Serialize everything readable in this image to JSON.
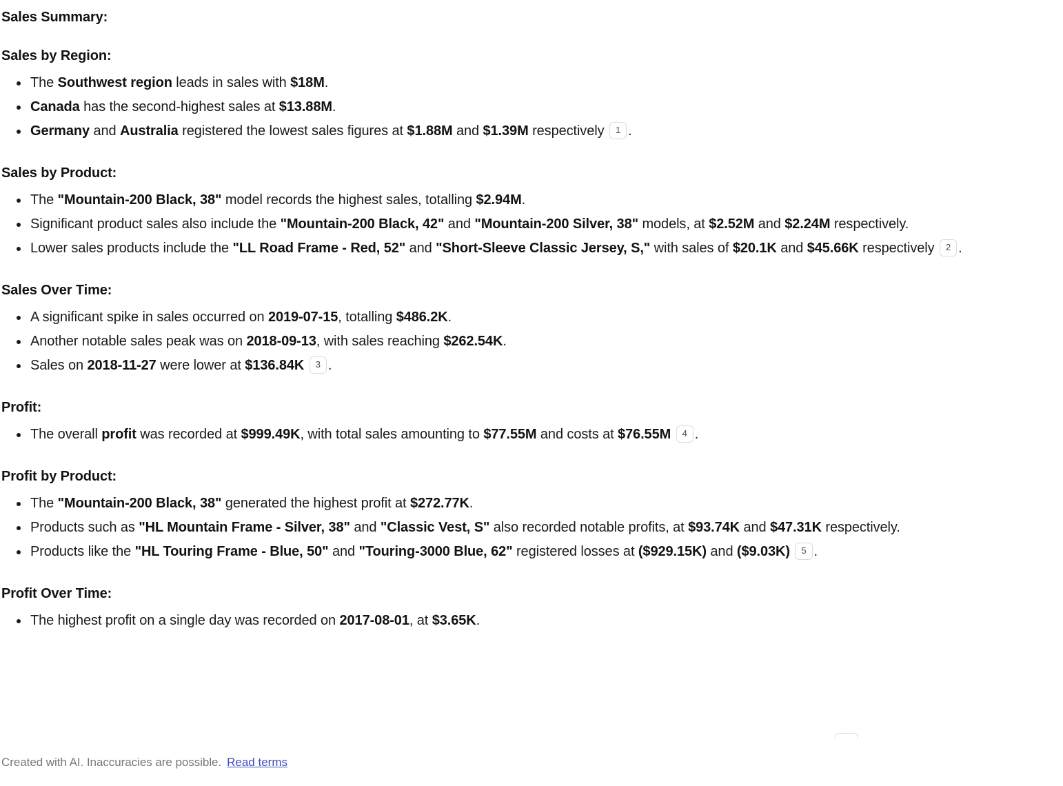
{
  "document": {
    "title": "Sales Summary:",
    "sections": [
      {
        "heading": "Sales by Region:",
        "bullets": [
          [
            {
              "t": "The ",
              "s": "n"
            },
            {
              "t": "Southwest region",
              "s": "b"
            },
            {
              "t": " leads in sales with ",
              "s": "n"
            },
            {
              "t": "$18M",
              "s": "b"
            },
            {
              "t": ".",
              "s": "n"
            }
          ],
          [
            {
              "t": "Canada",
              "s": "b"
            },
            {
              "t": " has the second-highest sales at ",
              "s": "n"
            },
            {
              "t": "$13.88M",
              "s": "b"
            },
            {
              "t": ".",
              "s": "n"
            }
          ],
          [
            {
              "t": "Germany",
              "s": "b"
            },
            {
              "t": " and ",
              "s": "n"
            },
            {
              "t": "Australia",
              "s": "b"
            },
            {
              "t": " registered the lowest sales figures at ",
              "s": "n"
            },
            {
              "t": "$1.88M",
              "s": "b"
            },
            {
              "t": " and ",
              "s": "n"
            },
            {
              "t": "$1.39M",
              "s": "b"
            },
            {
              "t": " respectively ",
              "s": "n"
            },
            {
              "t": "1",
              "s": "c"
            },
            {
              "t": ".",
              "s": "n"
            }
          ]
        ]
      },
      {
        "heading": "Sales by Product:",
        "bullets": [
          [
            {
              "t": "The ",
              "s": "n"
            },
            {
              "t": "\"Mountain-200 Black, 38\"",
              "s": "b"
            },
            {
              "t": " model records the highest sales, totalling ",
              "s": "n"
            },
            {
              "t": "$2.94M",
              "s": "b"
            },
            {
              "t": ".",
              "s": "n"
            }
          ],
          [
            {
              "t": "Significant product sales also include the ",
              "s": "n"
            },
            {
              "t": "\"Mountain-200 Black, 42\"",
              "s": "b"
            },
            {
              "t": " and ",
              "s": "n"
            },
            {
              "t": "\"Mountain-200 Silver, 38\"",
              "s": "b"
            },
            {
              "t": " models, at ",
              "s": "n"
            },
            {
              "t": "$2.52M",
              "s": "b"
            },
            {
              "t": " and ",
              "s": "n"
            },
            {
              "t": "$2.24M",
              "s": "b"
            },
            {
              "t": " respectively.",
              "s": "n"
            }
          ],
          [
            {
              "t": "Lower sales products include the ",
              "s": "n"
            },
            {
              "t": "\"LL Road Frame - Red, 52\"",
              "s": "b"
            },
            {
              "t": " and ",
              "s": "n"
            },
            {
              "t": "\"Short-Sleeve Classic Jersey, S,\"",
              "s": "b"
            },
            {
              "t": " with sales of ",
              "s": "n"
            },
            {
              "t": "$20.1K",
              "s": "b"
            },
            {
              "t": " and ",
              "s": "n"
            },
            {
              "t": "$45.66K",
              "s": "b"
            },
            {
              "t": " respectively ",
              "s": "n"
            },
            {
              "t": "2",
              "s": "c"
            },
            {
              "t": ".",
              "s": "n"
            }
          ]
        ]
      },
      {
        "heading": "Sales Over Time:",
        "bullets": [
          [
            {
              "t": "A significant spike in sales occurred on ",
              "s": "n"
            },
            {
              "t": "2019-07-15",
              "s": "b"
            },
            {
              "t": ", totalling ",
              "s": "n"
            },
            {
              "t": "$486.2K",
              "s": "b"
            },
            {
              "t": ".",
              "s": "n"
            }
          ],
          [
            {
              "t": "Another notable sales peak was on ",
              "s": "n"
            },
            {
              "t": "2018-09-13",
              "s": "b"
            },
            {
              "t": ", with sales reaching ",
              "s": "n"
            },
            {
              "t": "$262.54K",
              "s": "b"
            },
            {
              "t": ".",
              "s": "n"
            }
          ],
          [
            {
              "t": "Sales on ",
              "s": "n"
            },
            {
              "t": "2018-11-27",
              "s": "b"
            },
            {
              "t": " were lower at ",
              "s": "n"
            },
            {
              "t": "$136.84K",
              "s": "b"
            },
            {
              "t": " ",
              "s": "n"
            },
            {
              "t": "3",
              "s": "c"
            },
            {
              "t": ".",
              "s": "n"
            }
          ]
        ]
      },
      {
        "heading": "Profit:",
        "bullets": [
          [
            {
              "t": "The overall ",
              "s": "n"
            },
            {
              "t": "profit",
              "s": "b"
            },
            {
              "t": " was recorded at ",
              "s": "n"
            },
            {
              "t": "$999.49K",
              "s": "b"
            },
            {
              "t": ", with total sales amounting to ",
              "s": "n"
            },
            {
              "t": "$77.55M",
              "s": "b"
            },
            {
              "t": " and costs at ",
              "s": "n"
            },
            {
              "t": "$76.55M",
              "s": "b"
            },
            {
              "t": " ",
              "s": "n"
            },
            {
              "t": "4",
              "s": "c"
            },
            {
              "t": ".",
              "s": "n"
            }
          ]
        ]
      },
      {
        "heading": "Profit by Product:",
        "bullets": [
          [
            {
              "t": "The ",
              "s": "n"
            },
            {
              "t": "\"Mountain-200 Black, 38\"",
              "s": "b"
            },
            {
              "t": " generated the highest profit at ",
              "s": "n"
            },
            {
              "t": "$272.77K",
              "s": "b"
            },
            {
              "t": ".",
              "s": "n"
            }
          ],
          [
            {
              "t": "Products such as ",
              "s": "n"
            },
            {
              "t": "\"HL Mountain Frame - Silver, 38\"",
              "s": "b"
            },
            {
              "t": " and ",
              "s": "n"
            },
            {
              "t": "\"Classic Vest, S\"",
              "s": "b"
            },
            {
              "t": " also recorded notable profits, at ",
              "s": "n"
            },
            {
              "t": "$93.74K",
              "s": "b"
            },
            {
              "t": " and ",
              "s": "n"
            },
            {
              "t": "$47.31K",
              "s": "b"
            },
            {
              "t": " respectively.",
              "s": "n"
            }
          ],
          [
            {
              "t": "Products like the ",
              "s": "n"
            },
            {
              "t": "\"HL Touring Frame - Blue, 50\"",
              "s": "b"
            },
            {
              "t": " and ",
              "s": "n"
            },
            {
              "t": "\"Touring-3000 Blue, 62\"",
              "s": "b"
            },
            {
              "t": " registered losses at ",
              "s": "n"
            },
            {
              "t": "($929.15K)",
              "s": "b"
            },
            {
              "t": " and ",
              "s": "n"
            },
            {
              "t": "($9.03K)",
              "s": "b"
            },
            {
              "t": " ",
              "s": "n"
            },
            {
              "t": "5",
              "s": "c"
            },
            {
              "t": ".",
              "s": "n"
            }
          ]
        ]
      },
      {
        "heading": "Profit Over Time:",
        "bullets": [
          [
            {
              "t": "The highest profit on a single day was recorded on ",
              "s": "n"
            },
            {
              "t": "2017-08-01",
              "s": "b"
            },
            {
              "t": ", at ",
              "s": "n"
            },
            {
              "t": "$3.65K",
              "s": "b"
            },
            {
              "t": ".",
              "s": "n"
            }
          ]
        ]
      }
    ]
  },
  "footer": {
    "disclaimer": "Created with AI. Inaccuracies are possible.",
    "link_label": "Read terms"
  },
  "colors": {
    "text": "#1a1a1a",
    "heading": "#121212",
    "footer_text": "#767676",
    "link": "#3B4CC0",
    "citation_border": "#dcdcdc",
    "background": "#ffffff"
  }
}
